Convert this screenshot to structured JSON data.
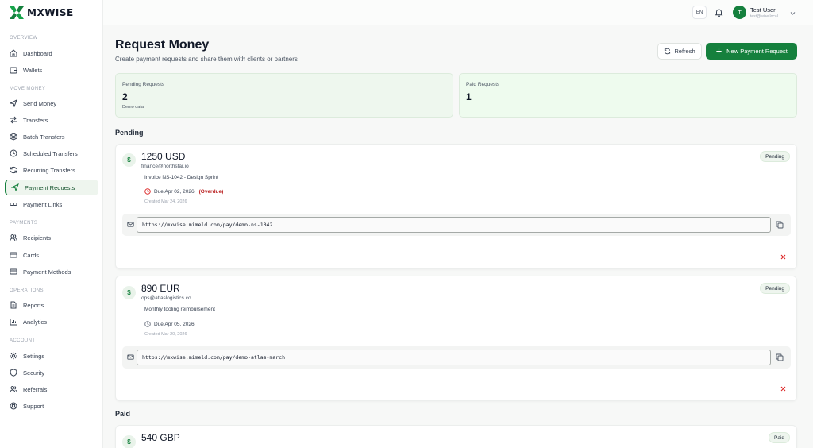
{
  "brand": {
    "name": "MXWISE",
    "accent": "#15803d"
  },
  "sidebar": {
    "sections": [
      {
        "label": "OVERVIEW",
        "items": [
          {
            "label": "Dashboard",
            "icon": "home-icon"
          },
          {
            "label": "Wallets",
            "icon": "wallet-icon"
          }
        ]
      },
      {
        "label": "MOVE MONEY",
        "items": [
          {
            "label": "Send Money",
            "icon": "send-icon"
          },
          {
            "label": "Transfers",
            "icon": "transfer-icon"
          },
          {
            "label": "Batch Transfers",
            "icon": "layers-icon"
          },
          {
            "label": "Scheduled Transfers",
            "icon": "clock-icon"
          },
          {
            "label": "Recurring Transfers",
            "icon": "repeat-icon"
          },
          {
            "label": "Payment Requests",
            "icon": "send-icon",
            "active": true
          },
          {
            "label": "Payment Links",
            "icon": "link-icon"
          }
        ]
      },
      {
        "label": "PAYMENTS",
        "items": [
          {
            "label": "Recipients",
            "icon": "users-icon"
          },
          {
            "label": "Cards",
            "icon": "card-icon"
          },
          {
            "label": "Payment Methods",
            "icon": "card-icon"
          }
        ]
      },
      {
        "label": "OPERATIONS",
        "items": [
          {
            "label": "Reports",
            "icon": "file-icon"
          },
          {
            "label": "Analytics",
            "icon": "chart-icon"
          }
        ]
      },
      {
        "label": "ACCOUNT",
        "items": [
          {
            "label": "Settings",
            "icon": "gear-icon"
          },
          {
            "label": "Security",
            "icon": "shield-icon"
          },
          {
            "label": "Referrals",
            "icon": "users-icon"
          },
          {
            "label": "Support",
            "icon": "support-icon"
          }
        ]
      }
    ]
  },
  "topbar": {
    "language": "EN",
    "user": {
      "initial": "T",
      "name": "Test User",
      "email": "test@wise.local"
    }
  },
  "header": {
    "title": "Request Money",
    "subtitle": "Create payment requests and share them with clients or partners",
    "refresh_label": "Refresh",
    "new_label": "New Payment Request"
  },
  "stats": {
    "pending": {
      "label": "Pending Requests",
      "value": "2",
      "note": "Demo data"
    },
    "paid": {
      "label": "Paid Requests",
      "value": "1"
    }
  },
  "groups": {
    "pending_title": "Pending",
    "paid_title": "Paid"
  },
  "requests": [
    {
      "amount": "1250 USD",
      "email": "finance@northstar.io",
      "description": "Invoice NS-1042 - Design Sprint",
      "due": "Due Apr 02, 2026",
      "overdue": "(Overdue)",
      "created": "Created Mar 24, 2026",
      "status": "Pending",
      "link": "https://mxwise.mimeld.com/pay/demo-ns-1042"
    },
    {
      "amount": "890 EUR",
      "email": "ops@atlaslogistics.co",
      "description": "Monthly tooling reimbursement",
      "due": "Due Apr 05, 2026",
      "created": "Created Mar 20, 2026",
      "status": "Pending",
      "link": "https://mxwise.mimeld.com/pay/demo-atlas-march"
    },
    {
      "amount": "540 GBP",
      "status": "Paid"
    }
  ]
}
